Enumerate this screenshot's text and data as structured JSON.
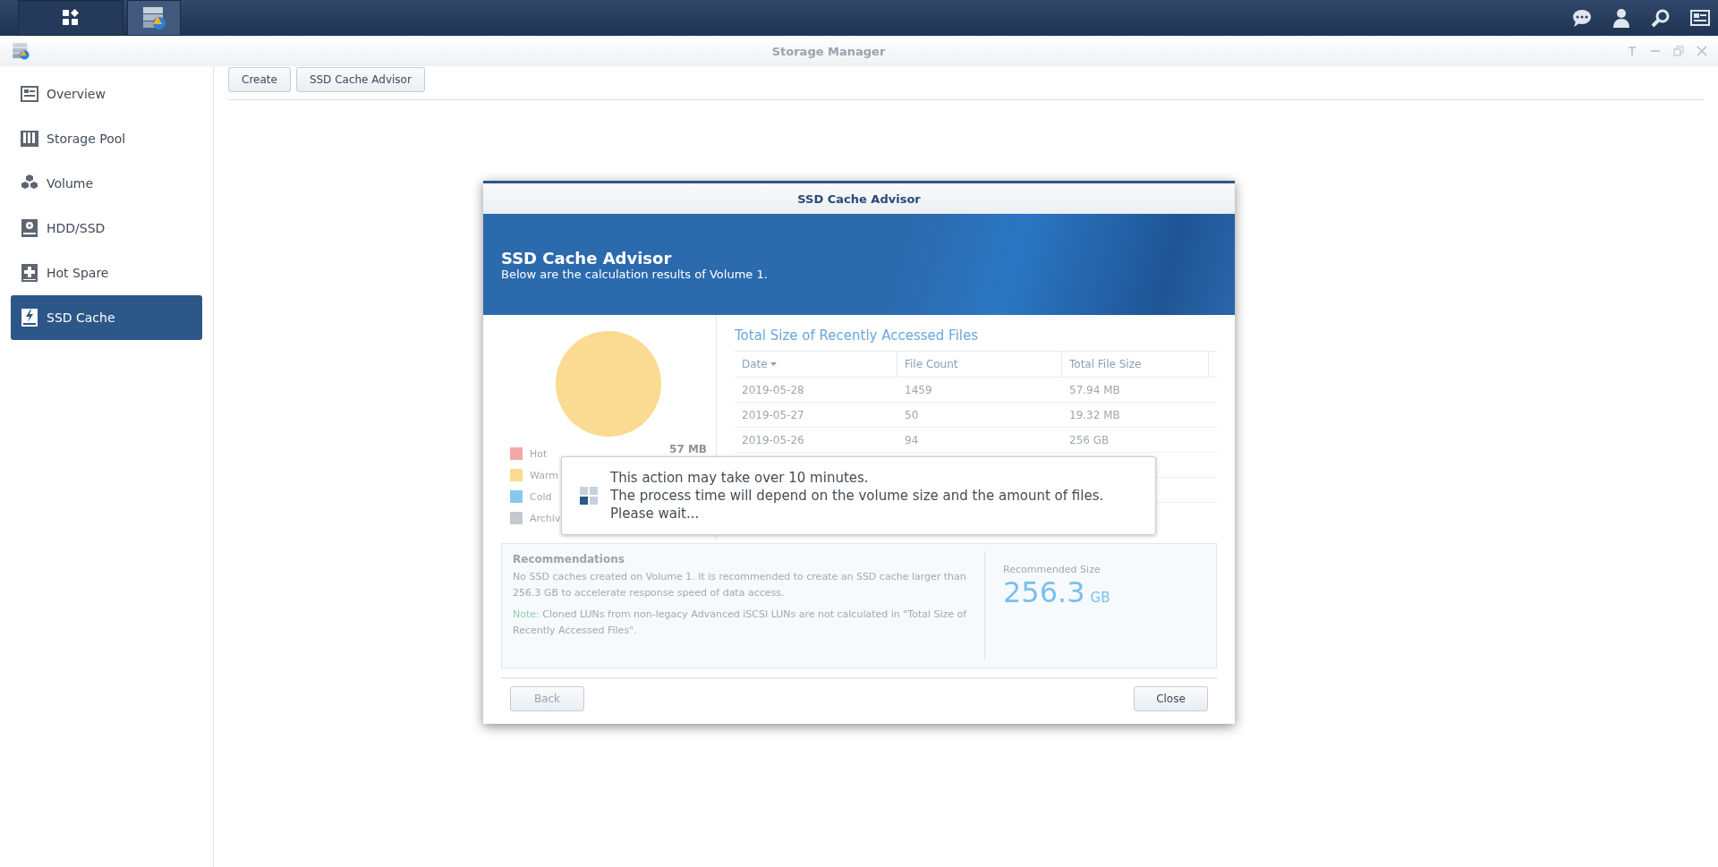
{
  "window": {
    "title": "Storage Manager"
  },
  "sidebar": {
    "items": [
      {
        "label": "Overview",
        "selected": false
      },
      {
        "label": "Storage Pool",
        "selected": false
      },
      {
        "label": "Volume",
        "selected": false
      },
      {
        "label": "HDD/SSD",
        "selected": false
      },
      {
        "label": "Hot Spare",
        "selected": false
      },
      {
        "label": "SSD Cache",
        "selected": true
      }
    ]
  },
  "toolbar": {
    "buttons": [
      "Create",
      "SSD Cache Advisor"
    ]
  },
  "dialog": {
    "title": "SSD Cache Advisor",
    "heading": "SSD Cache Advisor",
    "subheading": "Below are the calculation results of Volume 1.",
    "legend": [
      {
        "label": "Hot",
        "color": "#f4a7ab",
        "value": "57 MB"
      },
      {
        "label": "Warm",
        "color": "#fadb91"
      },
      {
        "label": "Cold",
        "color": "#87c9ee"
      },
      {
        "label": "Archiv",
        "color": "#c4c9cf"
      }
    ],
    "table": {
      "title": "Total Size of Recently Accessed Files",
      "columns": [
        "Date",
        "File Count",
        "Total File Size"
      ],
      "rows": [
        [
          "2019-05-28",
          "1459",
          "57.94 MB"
        ],
        [
          "2019-05-27",
          "50",
          "19.32 MB"
        ],
        [
          "2019-05-26",
          "94",
          "256 GB"
        ]
      ]
    },
    "recommendations": {
      "title": "Recommendations",
      "text": "No SSD caches created on Volume 1. It is recommended to create an SSD cache larger than 256.3 GB to accelerate response speed of data access.",
      "note_label": "Note:",
      "note": "Cloned LUNs from non-legacy Advanced iSCSI LUNs are not calculated in \"Total Size of Recently Accessed Files\".",
      "size_label": "Recommended Size",
      "size_value": "256.3",
      "size_unit": "GB"
    },
    "buttons": {
      "back": "Back",
      "close": "Close"
    },
    "toast": {
      "lines": [
        "This action may take over 10 minutes.",
        "The process time will depend on the volume size and the amount of files.",
        "Please wait..."
      ]
    }
  }
}
